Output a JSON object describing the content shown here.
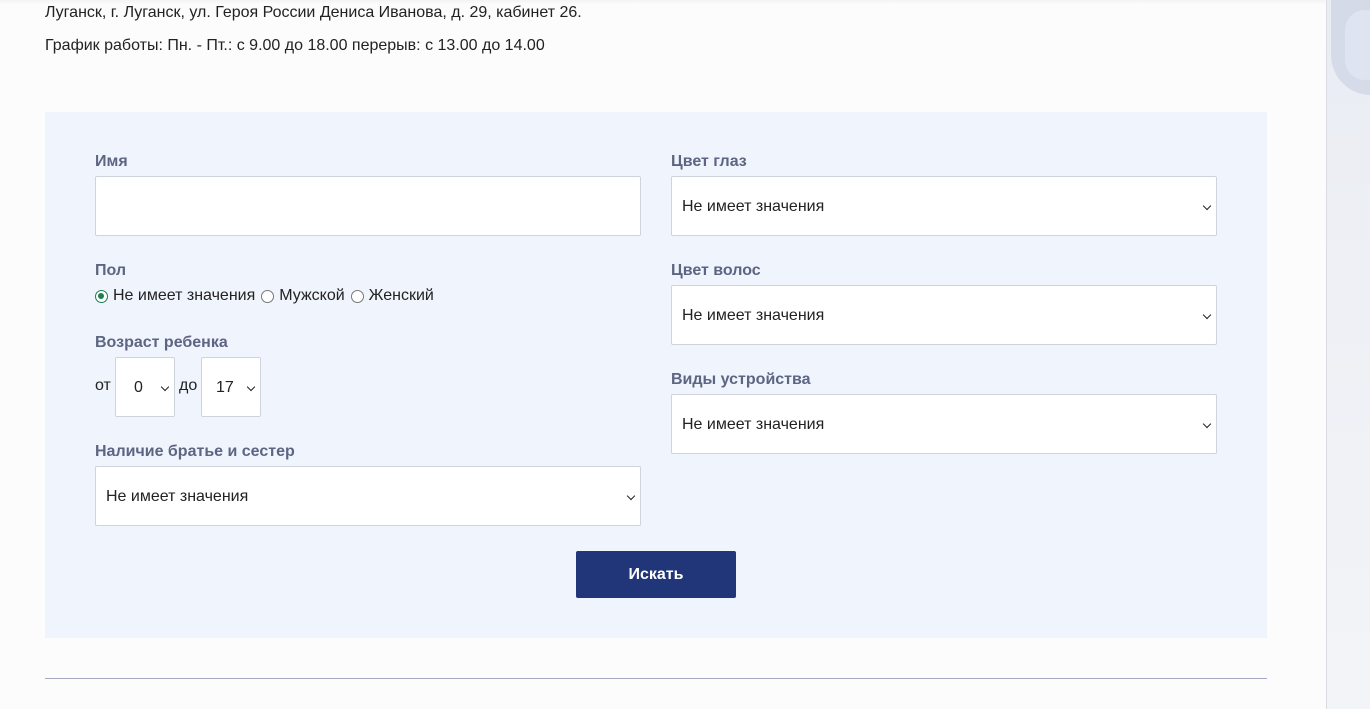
{
  "contact": {
    "address": "Луганск, г. Луганск, ул. Героя России Дениса Иванова, д. 29, кабинет 26.",
    "hours": "График работы: Пн. - Пт.: с 9.00 до 18.00 перерыв: с 13.00 до 14.00"
  },
  "form": {
    "name_label": "Имя",
    "name_value": "",
    "gender_label": "Пол",
    "gender_options": [
      "Не имеет значения",
      "Мужской",
      "Женский"
    ],
    "gender_selected": "Не имеет значения",
    "age_label": "Возраст ребенка",
    "age_from_label": "от",
    "age_from_value": "0",
    "age_to_label": "до",
    "age_to_value": "17",
    "siblings_label": "Наличие братье и сестер",
    "siblings_value": "Не имеет значения",
    "eye_color_label": "Цвет глаз",
    "eye_color_value": "Не имеет значения",
    "hair_color_label": "Цвет волос",
    "hair_color_value": "Не имеет значения",
    "placement_label": "Виды устройства",
    "placement_value": "Не имеет значения",
    "submit_label": "Искать"
  },
  "colors": {
    "panel_bg": "#eff4fd",
    "label_color": "#5d6582",
    "button_bg": "#213579",
    "radio_checked": "#1b7f4f"
  },
  "icons": {
    "select_arrow": "chevron-down-icon",
    "radio": "radio-button-icon"
  }
}
